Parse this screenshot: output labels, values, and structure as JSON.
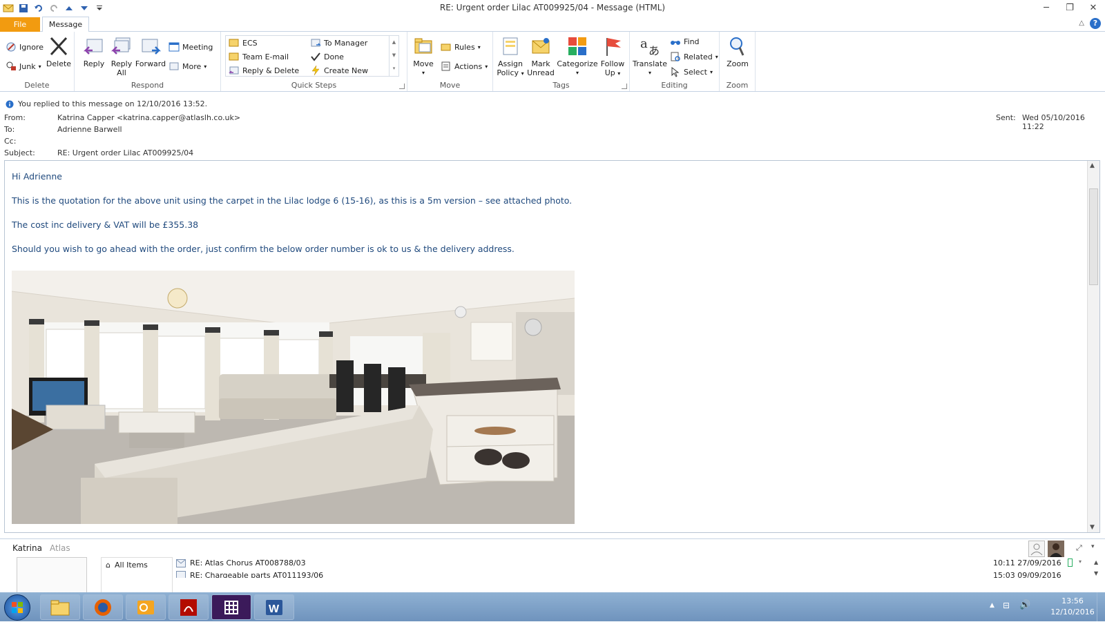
{
  "window": {
    "title": "RE: Urgent order Lilac  AT009925/04  -  Message (HTML)",
    "controls": [
      "─",
      "❐",
      "✕"
    ]
  },
  "tabs": {
    "file": "File",
    "message": "Message"
  },
  "ribbon": {
    "delete": {
      "label": "Delete",
      "ignore": "Ignore",
      "junk": "Junk",
      "delete": "Delete"
    },
    "respond": {
      "label": "Respond",
      "reply": "Reply",
      "reply_all_1": "Reply",
      "reply_all_2": "All",
      "forward": "Forward",
      "meeting": "Meeting",
      "more": "More"
    },
    "quick_steps": {
      "label": "Quick Steps",
      "items": [
        "ECS",
        "Team E-mail",
        "Reply & Delete",
        "To Manager",
        "Done",
        "Create New"
      ]
    },
    "move": {
      "label": "Move",
      "move": "Move",
      "rules": "Rules",
      "actions": "Actions"
    },
    "tags": {
      "label": "Tags",
      "assign_1": "Assign",
      "assign_2": "Policy",
      "mark_1": "Mark",
      "mark_2": "Unread",
      "categorize": "Categorize",
      "follow_1": "Follow",
      "follow_2": "Up"
    },
    "editing": {
      "label": "Editing",
      "translate": "Translate",
      "find": "Find",
      "related": "Related",
      "select": "Select"
    },
    "zoom": {
      "label": "Zoom",
      "zoom": "Zoom"
    }
  },
  "header": {
    "info": "You replied to this message on 12/10/2016 13:52.",
    "from_label": "From:",
    "from": "Katrina Capper <katrina.capper@atlaslh.co.uk>",
    "to_label": "To:",
    "to": "Adrienne Barwell",
    "cc_label": "Cc:",
    "subject_label": "Subject:",
    "subject": "RE: Urgent order Lilac  AT009925/04",
    "sent_label": "Sent:",
    "sent": "Wed 05/10/2016 11:22"
  },
  "body": {
    "p1": "Hi Adrienne",
    "p2": "This is the quotation for the above unit using the carpet in the Lilac lodge 6 (15-16), as this is a 5m version – see attached photo.",
    "p3": "The cost inc delivery & VAT will be £355.38",
    "p4": "Should you wish to go ahead with the order, just confirm the below order number is ok to us & the delivery address."
  },
  "people_pane": {
    "name": "Katrina",
    "company": "Atlas",
    "all_items": "All Items",
    "items": [
      {
        "subject": "RE: Atlas Chorus AT008788/03",
        "time": "10:11  27/09/2016"
      },
      {
        "subject": "RE: Chargeable parts AT011193/06",
        "time": "15:03  09/09/2016"
      }
    ]
  },
  "taskbar": {
    "time": "13:56",
    "date": "12/10/2016"
  }
}
